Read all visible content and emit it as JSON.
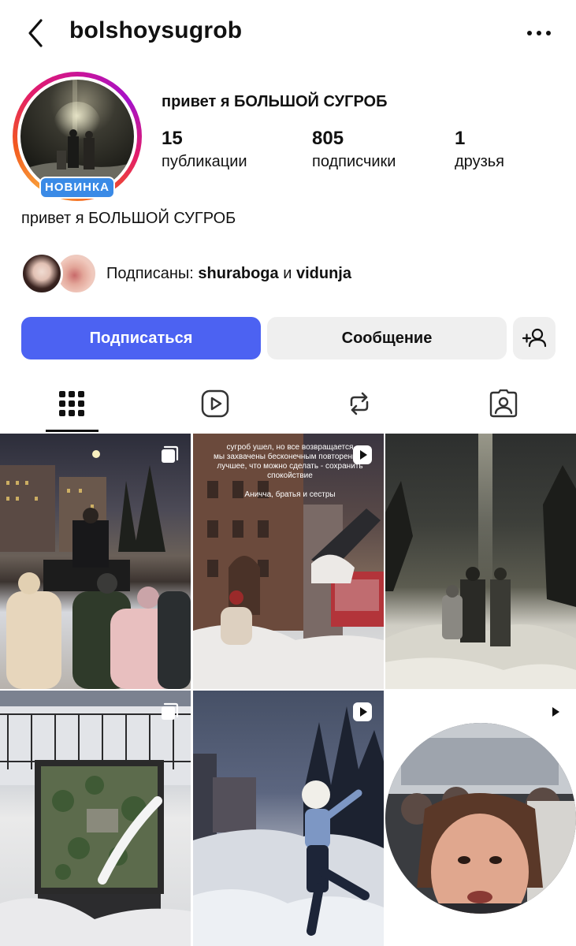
{
  "header": {
    "username": "bolshoysugrob",
    "back_icon": "chevron-left-icon",
    "more_icon": "more-horizontal-icon"
  },
  "profile": {
    "display_name": "привет я БОЛЬШОЙ СУГРОБ",
    "badge": "НОВИНКА",
    "bio": "привет я БОЛЬШОЙ СУГРОБ",
    "stats": {
      "posts_count": "15",
      "posts_label": "публикации",
      "followers_count": "805",
      "followers_label": "подписчики",
      "friends_count": "1",
      "friends_label": "друзья"
    }
  },
  "followed_by": {
    "prefix": "Подписаны:",
    "user1": "shuraboga",
    "conjunction": "и",
    "user2": "vidunja"
  },
  "actions": {
    "follow_label": "Подписаться",
    "message_label": "Сообщение",
    "add_friend_icon": "add-person-icon",
    "follow_color": "#4c62f2"
  },
  "tabs": [
    {
      "name": "grid",
      "icon": "grid-icon",
      "active": true
    },
    {
      "name": "reels",
      "icon": "reels-icon",
      "active": false
    },
    {
      "name": "reposts",
      "icon": "repost-icon",
      "active": false
    },
    {
      "name": "tagged",
      "icon": "tagged-icon",
      "active": false
    }
  ],
  "grid": {
    "post2_overlay": {
      "line1": "сугроб ушел, но все возвращается",
      "line2": "мы захвачены бесконечным повторением",
      "line3": "лучшее, что можно сделать - сохранить",
      "line4": "спокойствие",
      "signature": "Аничча, братья и сестры"
    },
    "posts": [
      {
        "type": "carousel",
        "badge_icon": "carousel-icon"
      },
      {
        "type": "reel",
        "badge_icon": "play-icon"
      },
      {
        "type": "photo"
      },
      {
        "type": "carousel",
        "badge_icon": "carousel-icon"
      },
      {
        "type": "reel",
        "badge_icon": "play-icon"
      },
      {
        "type": "reel",
        "badge_icon": "play-icon"
      }
    ]
  },
  "colors": {
    "badge_blue": "#3a8ae6",
    "secondary_button": "#efefef"
  }
}
